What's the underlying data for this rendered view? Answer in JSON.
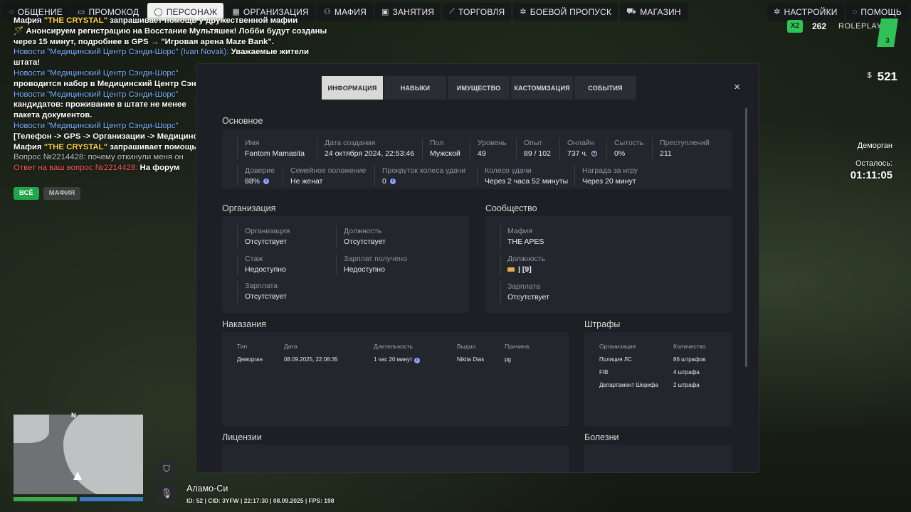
{
  "topbar": {
    "left": [
      {
        "label": "ОБЩЕНИЕ",
        "icon": "chat-icon"
      },
      {
        "label": "ПРОМОКОД",
        "icon": "ticket-icon"
      },
      {
        "label": "ПЕРСОНАЖ",
        "icon": "person-icon",
        "active": true
      },
      {
        "label": "ОРГАНИЗАЦИЯ",
        "icon": "building-icon"
      },
      {
        "label": "МАФИЯ",
        "icon": "group-icon"
      },
      {
        "label": "ЗАНЯТИЯ",
        "icon": "calendar-icon"
      },
      {
        "label": "ТОРГОВЛЯ",
        "icon": "chart-icon"
      },
      {
        "label": "БОЕВОЙ ПРОПУСК",
        "icon": "gear-icon"
      },
      {
        "label": "МАГАЗИН",
        "icon": "cart-icon"
      }
    ],
    "right": [
      {
        "label": "НАСТРОЙКИ",
        "icon": "settings-icon"
      },
      {
        "label": "ПОМОЩЬ",
        "icon": "help-icon"
      }
    ]
  },
  "chat": {
    "lines": [
      {
        "parts": [
          {
            "t": "Мафия ",
            "c": "white"
          },
          {
            "t": "\"THE CRYSTAL\"",
            "c": "yellow"
          },
          {
            "t": " запрашивает помощь у дружественной мафии",
            "c": "white"
          }
        ]
      },
      {
        "parts": [
          {
            "t": "🪄 Анонсируем регистрацию на Восстание Мультяшек! Лобби будут созданы",
            "c": "white"
          }
        ]
      },
      {
        "parts": [
          {
            "t": "через 15 минут, подробнее в GPS → \"Игровая арена Maze Bank\".",
            "c": "white"
          }
        ]
      },
      {
        "parts": [
          {
            "t": "Новости \"Медицинский Центр Сэнди-Шорс\" (Ivan Novak): ",
            "c": "blue"
          },
          {
            "t": "Уважаемые жители",
            "c": "white"
          }
        ]
      },
      {
        "parts": [
          {
            "t": "штата!",
            "c": "white"
          }
        ]
      },
      {
        "parts": [
          {
            "t": "Новости \"Медицинский Центр Сэнди-Шорс\"",
            "c": "blue"
          }
        ]
      },
      {
        "parts": [
          {
            "t": "проводится набор в Медицинский Центр Сэнди-Шорс",
            "c": "white"
          }
        ]
      },
      {
        "parts": [
          {
            "t": "Новости \"Медицинский Центр Сэнди-Шорс\"",
            "c": "blue"
          }
        ]
      },
      {
        "parts": [
          {
            "t": "кандидатов: проживание в штате не менее",
            "c": "white"
          }
        ]
      },
      {
        "parts": [
          {
            "t": "пакета документов.",
            "c": "white"
          }
        ]
      },
      {
        "parts": [
          {
            "t": "Новости \"Медицинский Центр Сэнди-Шорс\"",
            "c": "blue"
          }
        ]
      },
      {
        "parts": [
          {
            "t": "[Телефон -> GPS -> Организации -> Медицинский",
            "c": "white"
          }
        ]
      },
      {
        "parts": [
          {
            "t": "Мафия ",
            "c": "white"
          },
          {
            "t": "\"THE CRYSTAL\"",
            "c": "yellow"
          },
          {
            "t": " запрашивает помощь",
            "c": "white"
          }
        ]
      },
      {
        "parts": [
          {
            "t": "Вопрос №2214428: почему откинули меня он",
            "c": "gray"
          }
        ]
      },
      {
        "parts": [
          {
            "t": "Ответ на ваш вопрос №2214428: ",
            "c": "red"
          },
          {
            "t": "На форум",
            "c": "white"
          }
        ]
      }
    ],
    "tabs": [
      {
        "label": "ВСЁ",
        "active": true
      },
      {
        "label": "МАФИЯ",
        "active": false
      }
    ]
  },
  "hud": {
    "logo": {
      "badge": "X2",
      "num": "262",
      "text": "ROLEPLAY",
      "server": "3"
    },
    "money": {
      "currency": "$",
      "amount": "521"
    },
    "status": "Деморган",
    "remaining_label": "Осталось:",
    "remaining_time": "01:11:05",
    "map": {
      "north": "N"
    },
    "location": "Аламо-Си",
    "statusline": "ID: 52 | CID: 3YFW | 22:17:30 | 08.09.2025 | FPS: 198"
  },
  "modal": {
    "tabs": [
      {
        "label": "ИНФОРМАЦИЯ",
        "active": true
      },
      {
        "label": "НАВЫКИ"
      },
      {
        "label": "ИМУЩЕСТВО"
      },
      {
        "label": "КАСТОМИЗАЦИЯ"
      },
      {
        "label": "СОБЫТИЯ"
      }
    ],
    "close": "×",
    "basic": {
      "title": "Основное",
      "row1": [
        {
          "label": "Имя",
          "value": "Fantom Mamasita"
        },
        {
          "label": "Дата создания",
          "value": "24 октября 2024, 22:53:46"
        },
        {
          "label": "Пол",
          "value": "Мужской"
        },
        {
          "label": "Уровень",
          "value": "49"
        },
        {
          "label": "Опыт",
          "value": "89 / 102"
        },
        {
          "label": "Онлайн",
          "value": "737 ч."
        },
        {
          "label": "Сытость",
          "value": "0%"
        },
        {
          "label": "Преступлений",
          "value": "211"
        }
      ],
      "row2": [
        {
          "label": "Доверие",
          "value": "88%"
        },
        {
          "label": "Семейное положение",
          "value": "Не женат"
        },
        {
          "label": "Прокруток колеса удачи",
          "value": "0"
        },
        {
          "label": "Колесо удачи",
          "value": "Через 2 часа 52 минуты"
        },
        {
          "label": "Награда за игру",
          "value": "Через 20 минут"
        }
      ]
    },
    "organization": {
      "title": "Организация",
      "fields": [
        {
          "label": "Организация",
          "value": "Отсутствует"
        },
        {
          "label": "Должность",
          "value": "Отсутствует"
        },
        {
          "label": "Стаж",
          "value": "Недоступно"
        },
        {
          "label": "Зарплат получено",
          "value": "Недоступно"
        },
        {
          "label": "Зарплата",
          "value": "Отсутствует"
        }
      ]
    },
    "community": {
      "title": "Сообщество",
      "fields": [
        {
          "label": "Мафия",
          "value": "THE APES"
        },
        {
          "label": "Должность",
          "value": "| [9]"
        },
        {
          "label": "Зарплата",
          "value": "Отсутствует"
        }
      ]
    },
    "punishments": {
      "title": "Наказания",
      "headers": [
        "Тип",
        "Дата",
        "Длительность",
        "Выдал",
        "Причина"
      ],
      "rows": [
        [
          "Деморган",
          "08.09.2025, 22:08:35",
          "1 час 20 минут",
          "Nikita Dias",
          "pg"
        ]
      ]
    },
    "fines": {
      "title": "Штрафы",
      "headers": [
        "Организация",
        "Количество"
      ],
      "rows": [
        [
          "Полиция ЛС",
          "86 штрафов"
        ],
        [
          "FIB",
          "4 штрафа"
        ],
        [
          "Департамент Шерифа",
          "2 штрафа"
        ]
      ]
    },
    "licenses": {
      "title": "Лицензии"
    },
    "diseases": {
      "title": "Болезни"
    }
  }
}
